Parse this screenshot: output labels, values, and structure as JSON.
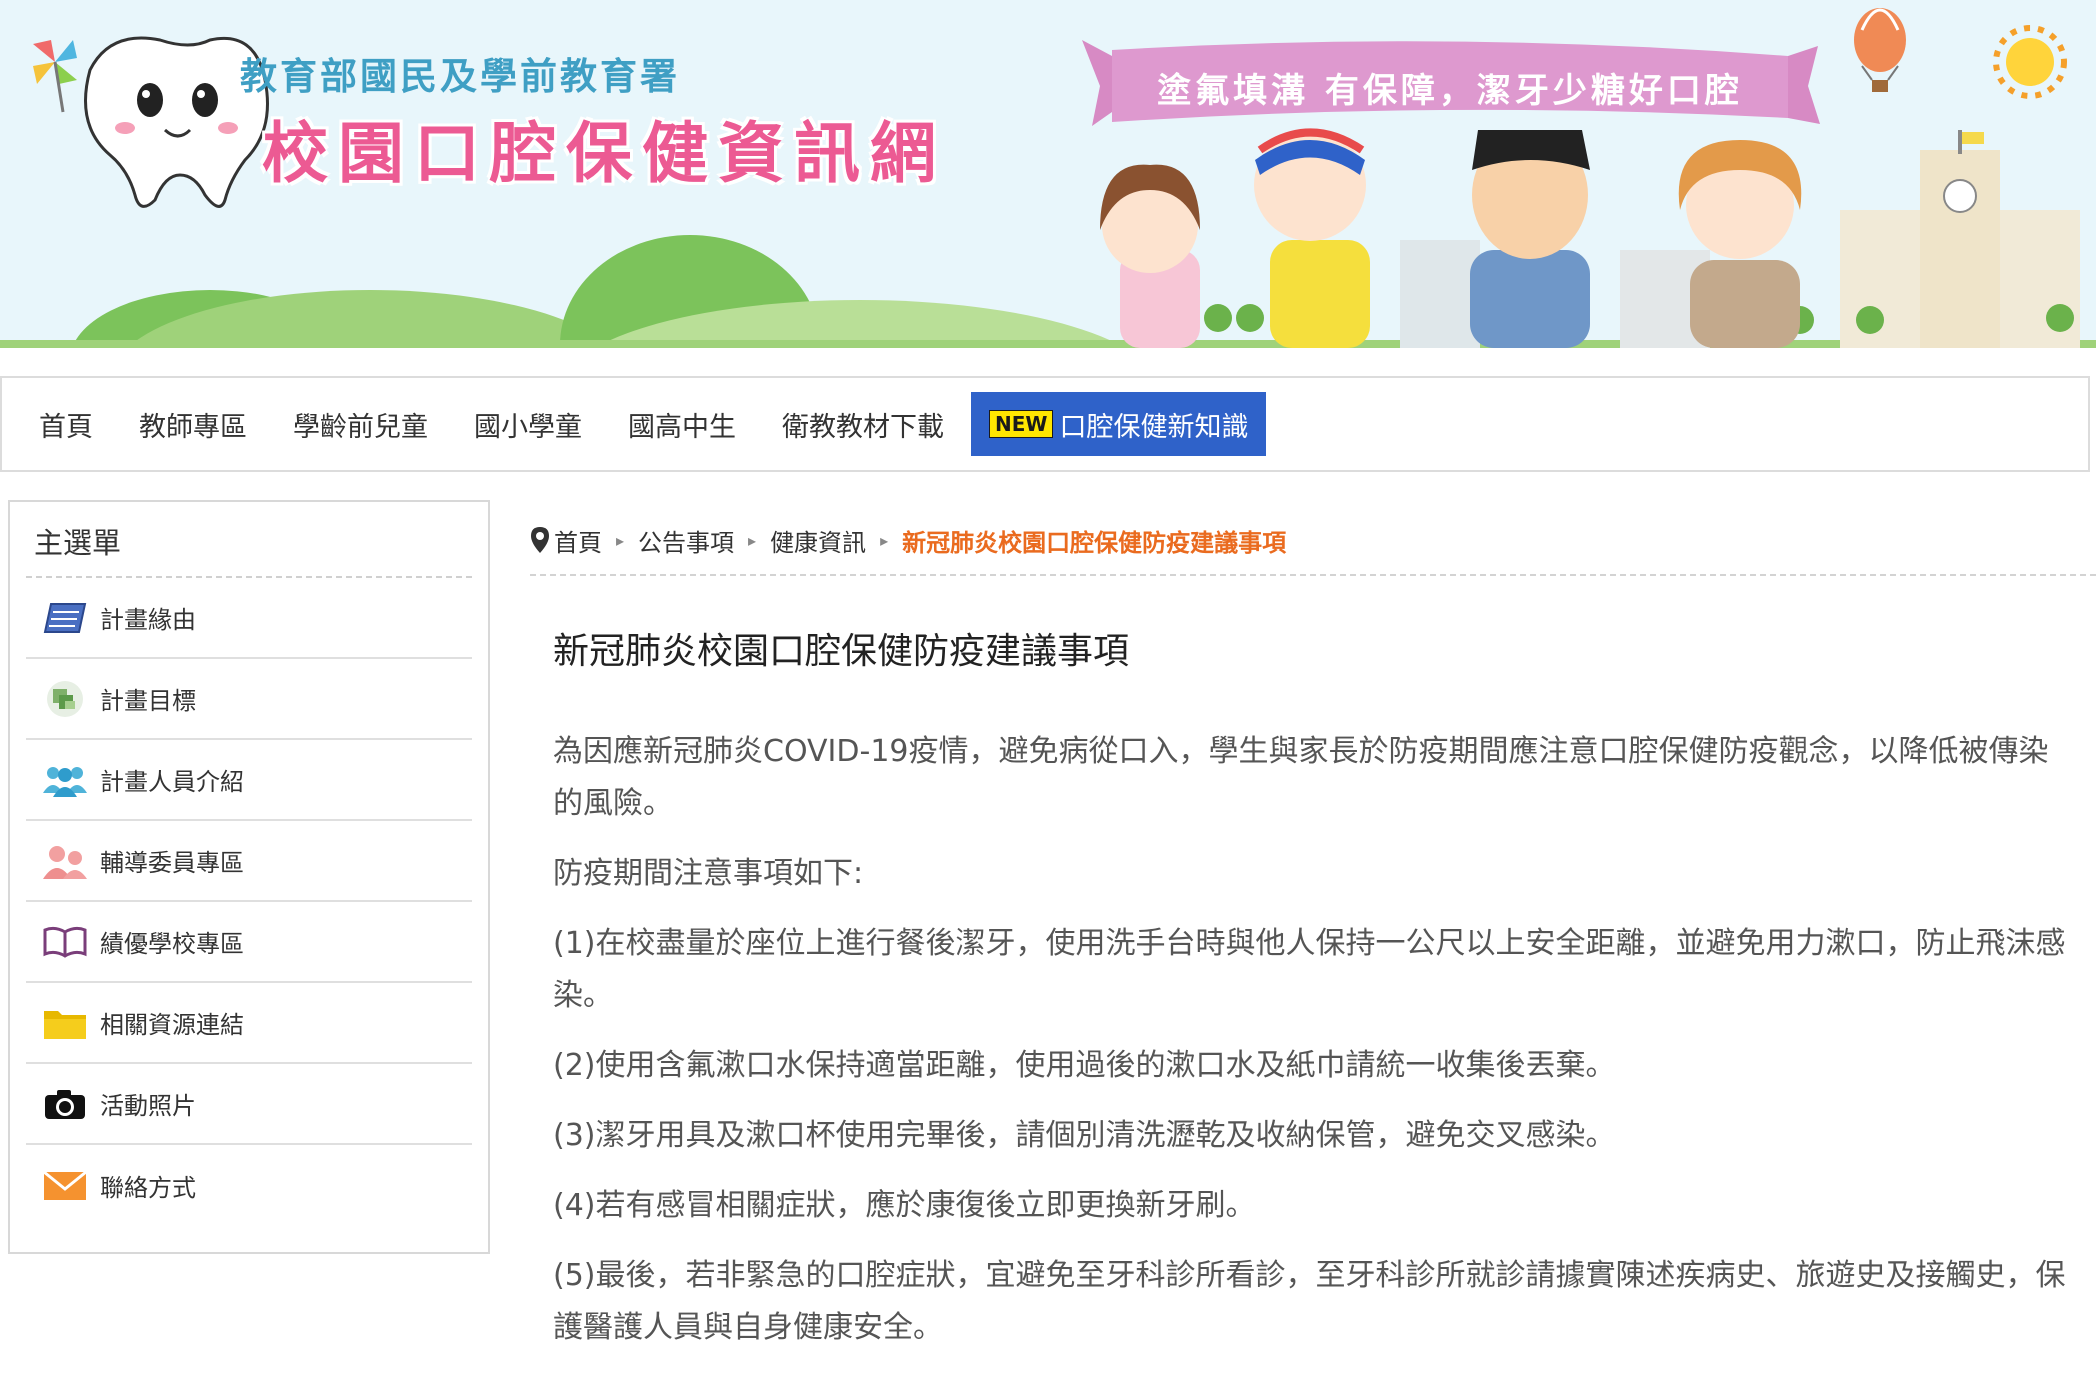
{
  "header": {
    "org_name": "教育部國民及學前教育署",
    "site_title": "校園口腔保健資訊網",
    "slogan": "塗氟填溝 有保障，潔牙少糖好口腔"
  },
  "nav": {
    "items": [
      {
        "label": "首頁"
      },
      {
        "label": "教師專區"
      },
      {
        "label": "學齡前兒童"
      },
      {
        "label": "國小學童"
      },
      {
        "label": "國高中生"
      },
      {
        "label": "衛教教材下載"
      }
    ],
    "active": {
      "badge": "NEW",
      "label": "口腔保健新知識"
    }
  },
  "sidebar": {
    "title": "主選單",
    "items": [
      {
        "label": "計畫緣由",
        "icon": "notebook-icon"
      },
      {
        "label": "計畫目標",
        "icon": "target-icon"
      },
      {
        "label": "計畫人員介紹",
        "icon": "people-icon"
      },
      {
        "label": "輔導委員專區",
        "icon": "committee-icon"
      },
      {
        "label": "績優學校專區",
        "icon": "book-icon"
      },
      {
        "label": "相關資源連結",
        "icon": "folder-icon"
      },
      {
        "label": "活動照片",
        "icon": "camera-icon"
      },
      {
        "label": "聯絡方式",
        "icon": "mail-icon"
      }
    ]
  },
  "breadcrumb": {
    "items": [
      "首頁",
      "公告事項",
      "健康資訊"
    ],
    "current": "新冠肺炎校園口腔保健防疫建議事項"
  },
  "article": {
    "title": "新冠肺炎校園口腔保健防疫建議事項",
    "paragraphs": [
      "為因應新冠肺炎COVID-19疫情，避免病從口入，學生與家長於防疫期間應注意口腔保健防疫觀念，以降低被傳染的風險。",
      "防疫期間注意事項如下:",
      "(1)在校盡量於座位上進行餐後潔牙，使用洗手台時與他人保持一公尺以上安全距離，並避免用力漱口，防止飛沫感染。",
      "(2)使用含氟漱口水保持適當距離，使用過後的漱口水及紙巾請統一收集後丟棄。",
      "(3)潔牙用具及漱口杯使用完畢後，請個別清洗瀝乾及收納保管，避免交叉感染。",
      "(4)若有感冒相關症狀，應於康復後立即更換新牙刷。",
      "(5)最後，若非緊急的口腔症狀，宜避免至牙科診所看診，至牙科診所就診請據實陳述疾病史、旅遊史及接觸史，保護醫護人員與自身健康安全。"
    ]
  },
  "colors": {
    "nav_active": "#2f62c9",
    "breadcrumb_current": "#ea6b1f",
    "title_pink": "#ec5a93",
    "org_blue": "#3f9fc4"
  }
}
